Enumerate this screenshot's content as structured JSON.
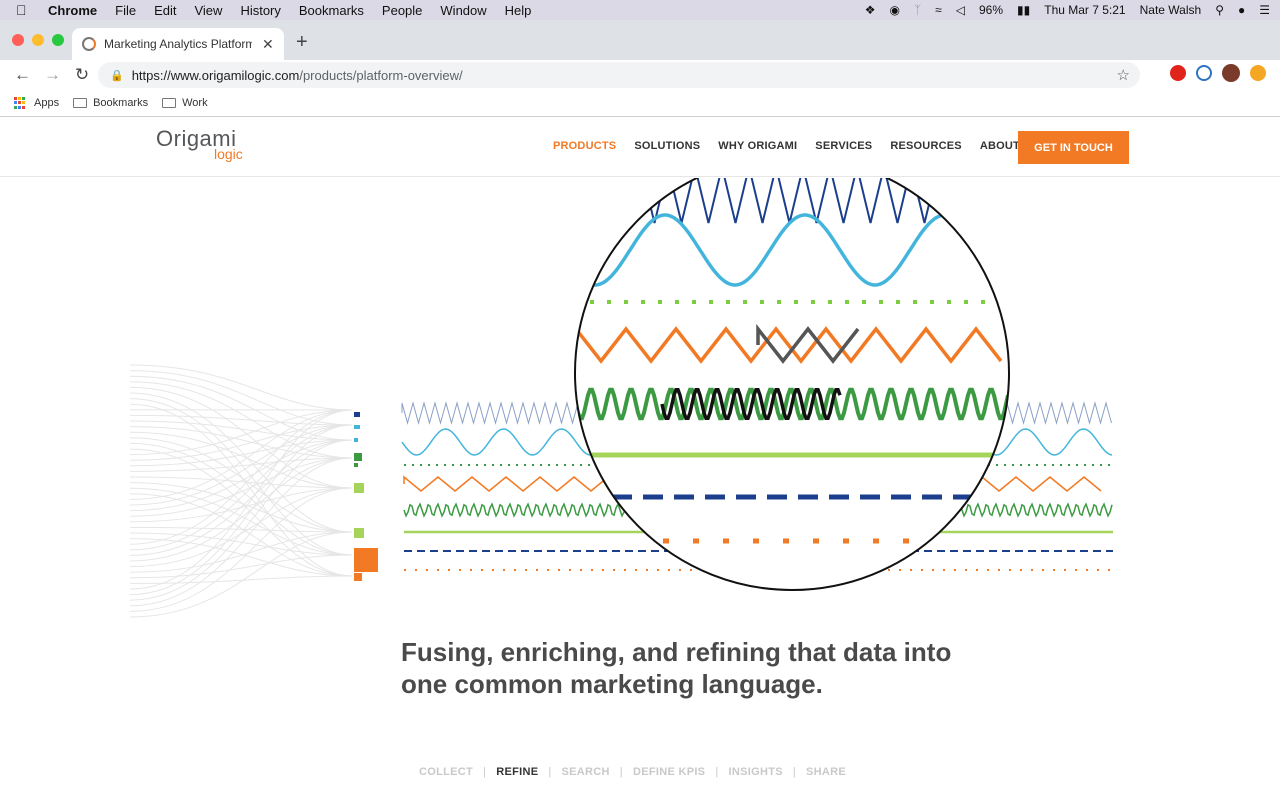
{
  "menubar": {
    "app": "Chrome",
    "items": [
      "File",
      "Edit",
      "View",
      "History",
      "Bookmarks",
      "People",
      "Window",
      "Help"
    ],
    "battery": "96%",
    "clock": "Thu Mar 7  5:21",
    "user": "Nate Walsh"
  },
  "browser": {
    "tab_title": "Marketing Analytics Platform |",
    "url_host": "https://www.origamilogic.com",
    "url_path": "/products/platform-overview/",
    "bookmarks": [
      "Apps",
      "Bookmarks",
      "Work"
    ]
  },
  "site": {
    "logo_top": "Origami",
    "logo_bottom": "logic",
    "nav": [
      "PRODUCTS",
      "SOLUTIONS",
      "WHY ORIGAMI",
      "SERVICES",
      "RESOURCES",
      "ABOUT"
    ],
    "cta": "GET IN TOUCH",
    "tagline_1": "Fusing, enriching, and refining that data into",
    "tagline_2": "one common marketing language.",
    "steps": [
      "COLLECT",
      "REFINE",
      "SEARCH",
      "DEFINE KPIS",
      "INSIGHTS",
      "SHARE"
    ]
  },
  "colors": {
    "orange": "#f27a25",
    "navy": "#1b3f8c",
    "sky": "#43b5dc",
    "green": "#3c9b42",
    "lime": "#a6d45a"
  }
}
